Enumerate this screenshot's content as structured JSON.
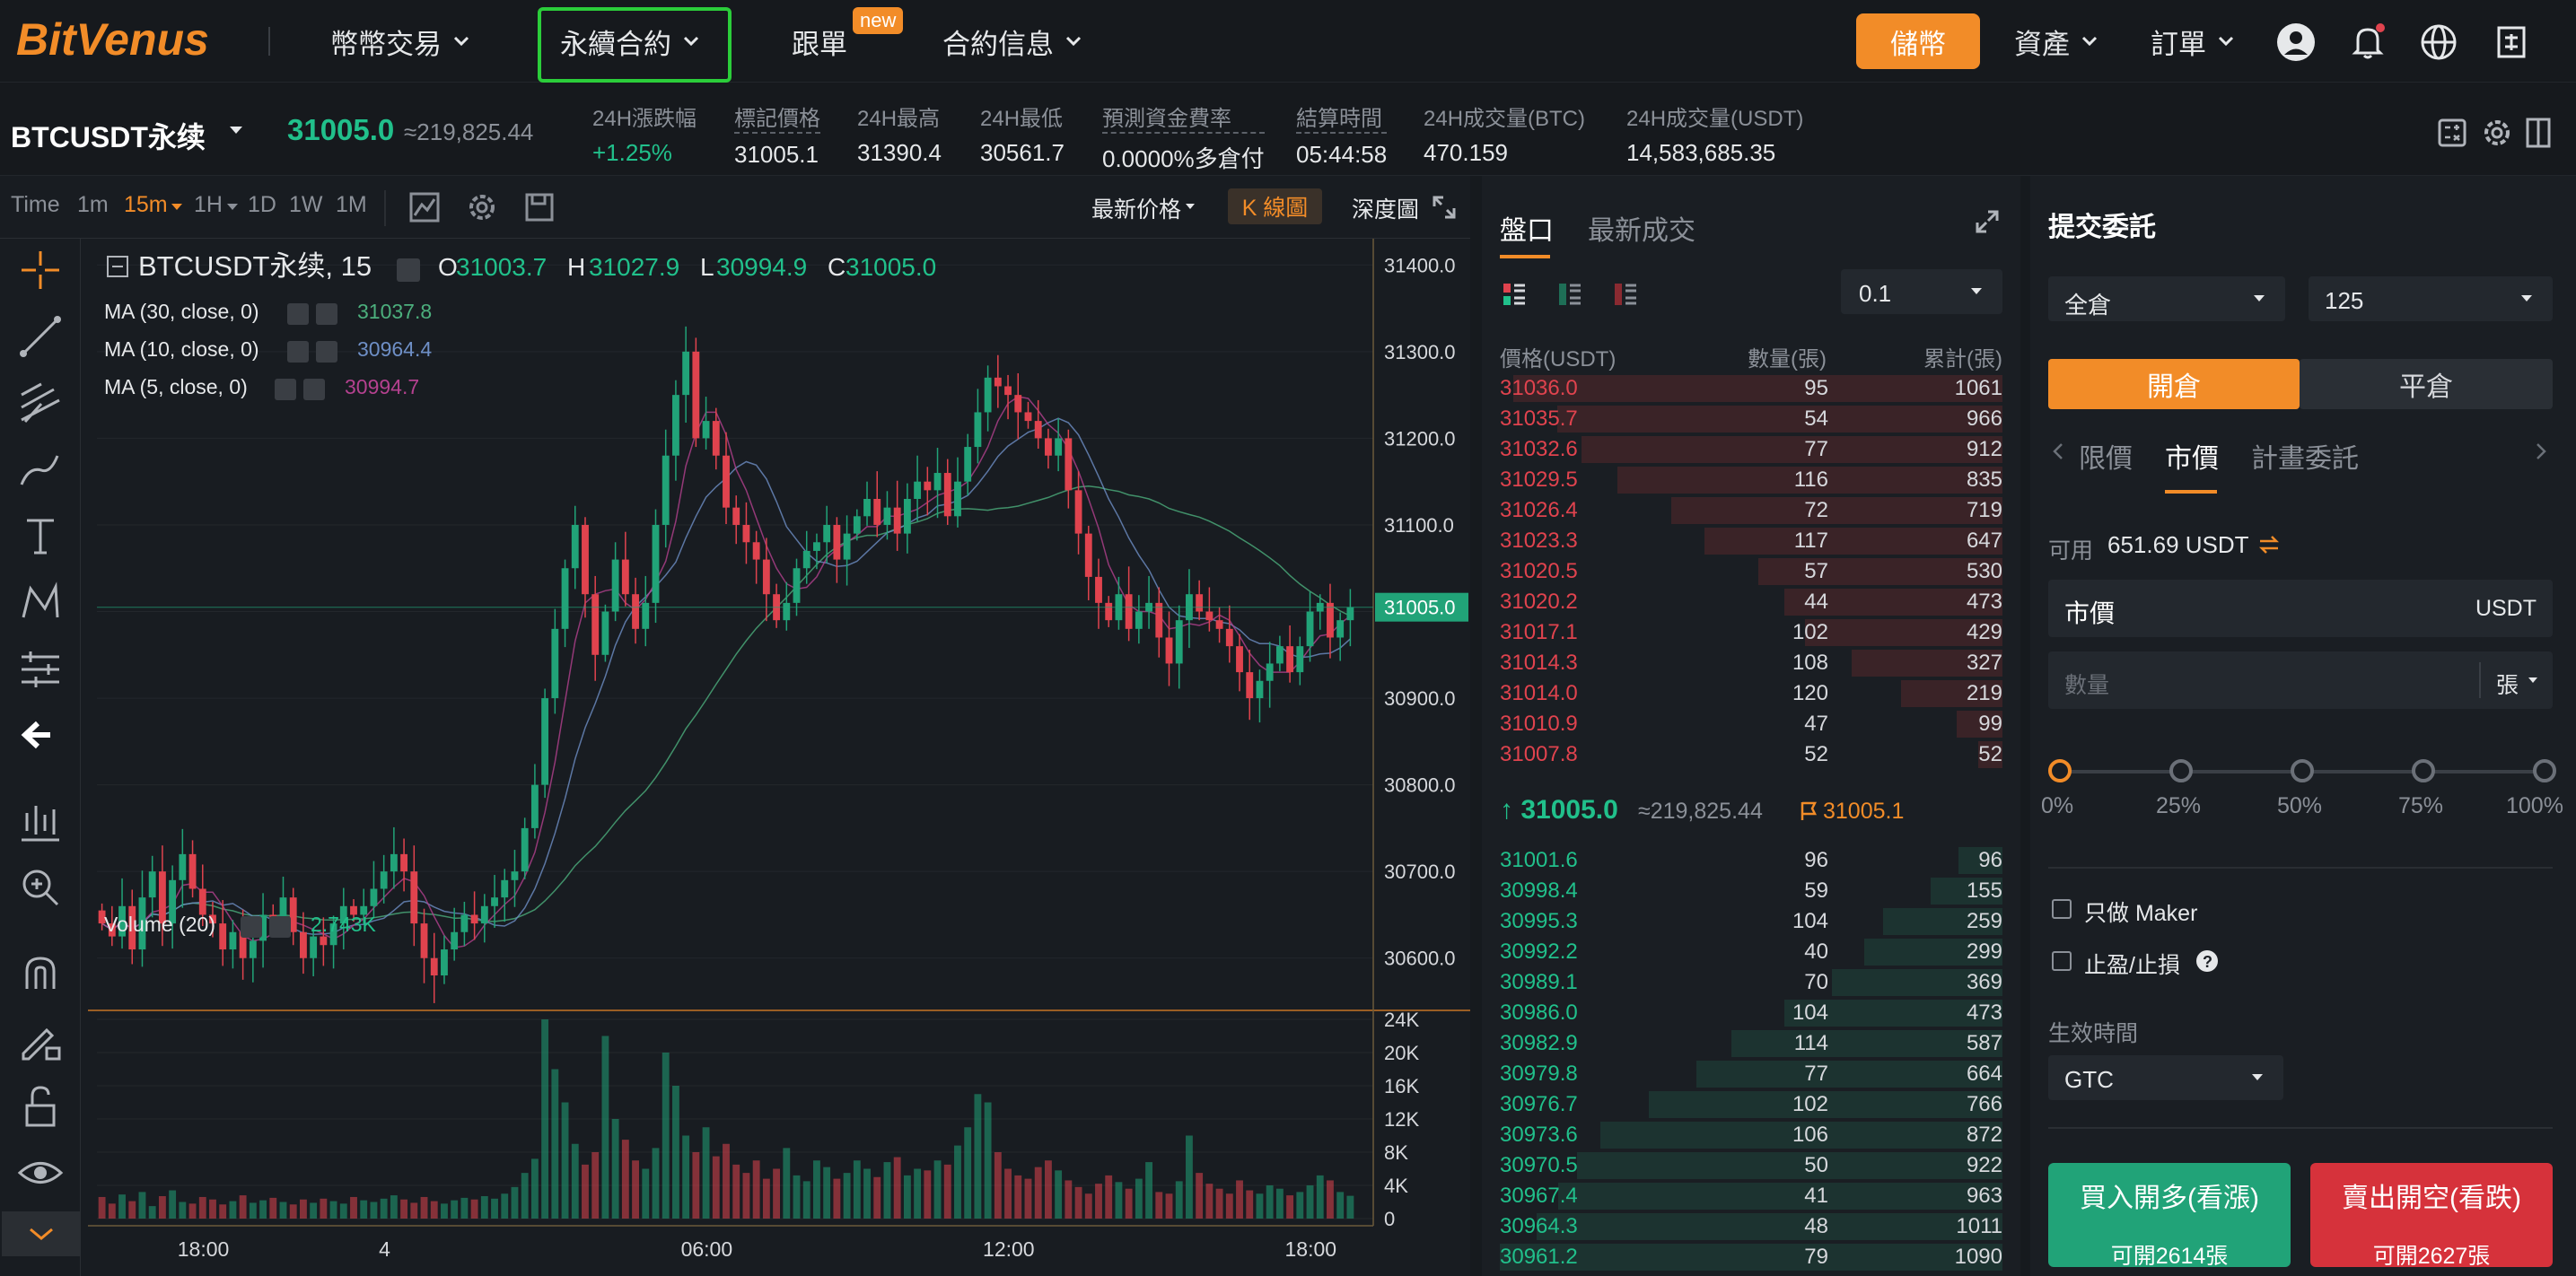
{
  "nav": {
    "brand": "BitVenus",
    "spot": "幣幣交易",
    "futures": "永續合約",
    "copy": "跟單",
    "copy_badge": "new",
    "info": "合約信息",
    "deposit": "儲幣",
    "assets": "資產",
    "orders": "訂單"
  },
  "ticker": {
    "symbol": "BTCUSDT永续",
    "last": "31005.0",
    "last_approx": "≈219,825.44",
    "stats": [
      {
        "label": "24H漲跌幅",
        "value": "+1.25%"
      },
      {
        "label": "標記價格",
        "value": "31005.1"
      },
      {
        "label": "24H最高",
        "value": "31390.4"
      },
      {
        "label": "24H最低",
        "value": "30561.7"
      },
      {
        "label": "預測資金費率",
        "value": "0.0000%多倉付"
      },
      {
        "label": "結算時間",
        "value": "05:44:58"
      },
      {
        "label": "24H成交量(BTC)",
        "value": "470.159"
      },
      {
        "label": "24H成交量(USDT)",
        "value": "14,583,685.35"
      }
    ]
  },
  "toolbar": {
    "time": "Time",
    "intervals": [
      "1m",
      "15m",
      "1H",
      "1D",
      "1W",
      "1M"
    ],
    "active_interval": "15m",
    "price_type": "最新价格",
    "kline": "K 線圖",
    "depth": "深度圖"
  },
  "chart_legend": {
    "title": "BTCUSDT永续, 15",
    "o_label": "O",
    "o": "31003.7",
    "h_label": "H",
    "h": "31027.9",
    "l_label": "L",
    "l": "30994.9",
    "c_label": "C",
    "c": "31005.0",
    "ma30": "MA (30, close, 0)",
    "ma30_val": "31037.8",
    "ma10": "MA (10, close, 0)",
    "ma10_val": "30964.4",
    "ma5": "MA (5, close, 0)",
    "ma5_val": "30994.7",
    "volume": "Volume (20)",
    "volume_val": "2.743K"
  },
  "chart_data": {
    "type": "candlestick",
    "price_axis": [
      "31400.0",
      "31300.0",
      "31200.0",
      "31100.0",
      "31000.0",
      "30900.0",
      "30800.0",
      "30700.0",
      "30600.0"
    ],
    "price_ylim": [
      30550,
      31420
    ],
    "current_price": "31005.0",
    "volume_axis": [
      "24K",
      "20K",
      "16K",
      "12K",
      "8K",
      "4K",
      "0"
    ],
    "volume_ylim": [
      0,
      24000
    ],
    "x_ticks": [
      "18:00",
      "4",
      "06:00",
      "12:00",
      "18:00"
    ],
    "closes": [
      30640,
      30625,
      30660,
      30610,
      30670,
      30700,
      30640,
      30690,
      30720,
      30680,
      30650,
      30640,
      30610,
      30630,
      30600,
      30620,
      30650,
      30640,
      30670,
      30630,
      30600,
      30625,
      30615,
      30640,
      30660,
      30650,
      30660,
      30680,
      30700,
      30720,
      30700,
      30640,
      30600,
      30580,
      30610,
      30630,
      30650,
      30640,
      30660,
      30670,
      30690,
      30700,
      30750,
      30800,
      30900,
      30980,
      31050,
      31100,
      31020,
      30950,
      31000,
      31060,
      31020,
      30980,
      31010,
      31100,
      31180,
      31250,
      31300,
      31200,
      31220,
      31180,
      31120,
      31100,
      31080,
      31060,
      31020,
      30990,
      31010,
      31050,
      31070,
      31080,
      31100,
      31060,
      31090,
      31110,
      31130,
      31100,
      31120,
      31090,
      31130,
      31150,
      31140,
      31160,
      31110,
      31150,
      31190,
      31230,
      31270,
      31260,
      31250,
      31230,
      31220,
      31200,
      31180,
      31200,
      31140,
      31090,
      31040,
      31010,
      30990,
      31020,
      30980,
      31000,
      31010,
      30970,
      30940,
      30990,
      31020,
      31000,
      30990,
      30980,
      30960,
      30930,
      30900,
      30920,
      30940,
      30960,
      30930,
      30960,
      31000,
      31010,
      30970,
      30990,
      31005
    ],
    "volumes": [
      2600,
      1800,
      2900,
      2100,
      3200,
      1500,
      2700,
      3400,
      2000,
      1800,
      2600,
      2300,
      1700,
      2100,
      2800,
      1900,
      2200,
      2500,
      2000,
      1700,
      2300,
      1900,
      2400,
      2100,
      1800,
      2600,
      2200,
      2000,
      2400,
      2800,
      2300,
      1900,
      2600,
      2100,
      1800,
      2200,
      2500,
      2300,
      2700,
      2400,
      3000,
      3800,
      5500,
      7200,
      24000,
      18000,
      14000,
      9000,
      6500,
      8000,
      22000,
      12000,
      9500,
      7000,
      6000,
      8500,
      20000,
      16000,
      10000,
      8000,
      11000,
      7500,
      9000,
      6500,
      5500,
      7000,
      4800,
      6000,
      8500,
      5200,
      4500,
      7000,
      6200,
      4800,
      5500,
      7000,
      6000,
      5000,
      6800,
      7400,
      5200,
      6000,
      5800,
      7000,
      6500,
      8800,
      11000,
      15000,
      14000,
      8000,
      6000,
      5200,
      4800,
      6200,
      7000,
      5800,
      4600,
      3800,
      3000,
      4200,
      5200,
      4400,
      3600,
      4800,
      6800,
      3200,
      3000,
      4500,
      10000,
      5500,
      4200,
      3600,
      3000,
      4600,
      3400,
      3000,
      4000,
      3600,
      2800,
      3200,
      4000,
      5200,
      4600,
      3200,
      2743
    ]
  },
  "orderbook": {
    "tab_book": "盤口",
    "tab_trades": "最新成交",
    "precision": "0.1",
    "head_price": "價格(USDT)",
    "head_qty": "數量(張)",
    "head_total": "累計(張)",
    "asks": [
      {
        "p": "31036.0",
        "q": "95",
        "t": "1061"
      },
      {
        "p": "31035.7",
        "q": "54",
        "t": "966"
      },
      {
        "p": "31032.6",
        "q": "77",
        "t": "912"
      },
      {
        "p": "31029.5",
        "q": "116",
        "t": "835"
      },
      {
        "p": "31026.4",
        "q": "72",
        "t": "719"
      },
      {
        "p": "31023.3",
        "q": "117",
        "t": "647"
      },
      {
        "p": "31020.5",
        "q": "57",
        "t": "530"
      },
      {
        "p": "31020.2",
        "q": "44",
        "t": "473"
      },
      {
        "p": "31017.1",
        "q": "102",
        "t": "429"
      },
      {
        "p": "31014.3",
        "q": "108",
        "t": "327"
      },
      {
        "p": "31014.0",
        "q": "120",
        "t": "219"
      },
      {
        "p": "31010.9",
        "q": "47",
        "t": "99"
      },
      {
        "p": "31007.8",
        "q": "52",
        "t": "52"
      }
    ],
    "mid_price": "↑ 31005.0",
    "mid_approx": "≈219,825.44",
    "mid_mark": "31005.1",
    "bids": [
      {
        "p": "31001.6",
        "q": "96",
        "t": "96"
      },
      {
        "p": "30998.4",
        "q": "59",
        "t": "155"
      },
      {
        "p": "30995.3",
        "q": "104",
        "t": "259"
      },
      {
        "p": "30992.2",
        "q": "40",
        "t": "299"
      },
      {
        "p": "30989.1",
        "q": "70",
        "t": "369"
      },
      {
        "p": "30986.0",
        "q": "104",
        "t": "473"
      },
      {
        "p": "30982.9",
        "q": "114",
        "t": "587"
      },
      {
        "p": "30979.8",
        "q": "77",
        "t": "664"
      },
      {
        "p": "30976.7",
        "q": "102",
        "t": "766"
      },
      {
        "p": "30973.6",
        "q": "106",
        "t": "872"
      },
      {
        "p": "30970.5",
        "q": "50",
        "t": "922"
      },
      {
        "p": "30967.4",
        "q": "41",
        "t": "963"
      },
      {
        "p": "30964.3",
        "q": "48",
        "t": "1011"
      },
      {
        "p": "30961.2",
        "q": "79",
        "t": "1090"
      }
    ]
  },
  "order": {
    "title": "提交委託",
    "margin_mode": "全倉",
    "leverage": "125",
    "open": "開倉",
    "close": "平倉",
    "tab_limit": "限價",
    "tab_market": "市價",
    "tab_plan": "計畫委託",
    "available_label": "可用",
    "available": "651.69 USDT",
    "price_field": "市價",
    "price_unit": "USDT",
    "qty_placeholder": "數量",
    "qty_unit": "張",
    "pcts": [
      "0%",
      "25%",
      "50%",
      "75%",
      "100%"
    ],
    "maker_only": "只做 Maker",
    "tpsl": "止盈/止損",
    "tif_label": "生效時間",
    "tif": "GTC",
    "buy_label": "買入開多(看漲)",
    "buy_sub": "可開2614張",
    "sell_label": "賣出開空(看跌)",
    "sell_sub": "可開2627張"
  },
  "colors": {
    "up": "#21c08b",
    "down": "#e0434e",
    "accent": "#f28c28",
    "highlight": "#2bcd3a"
  }
}
